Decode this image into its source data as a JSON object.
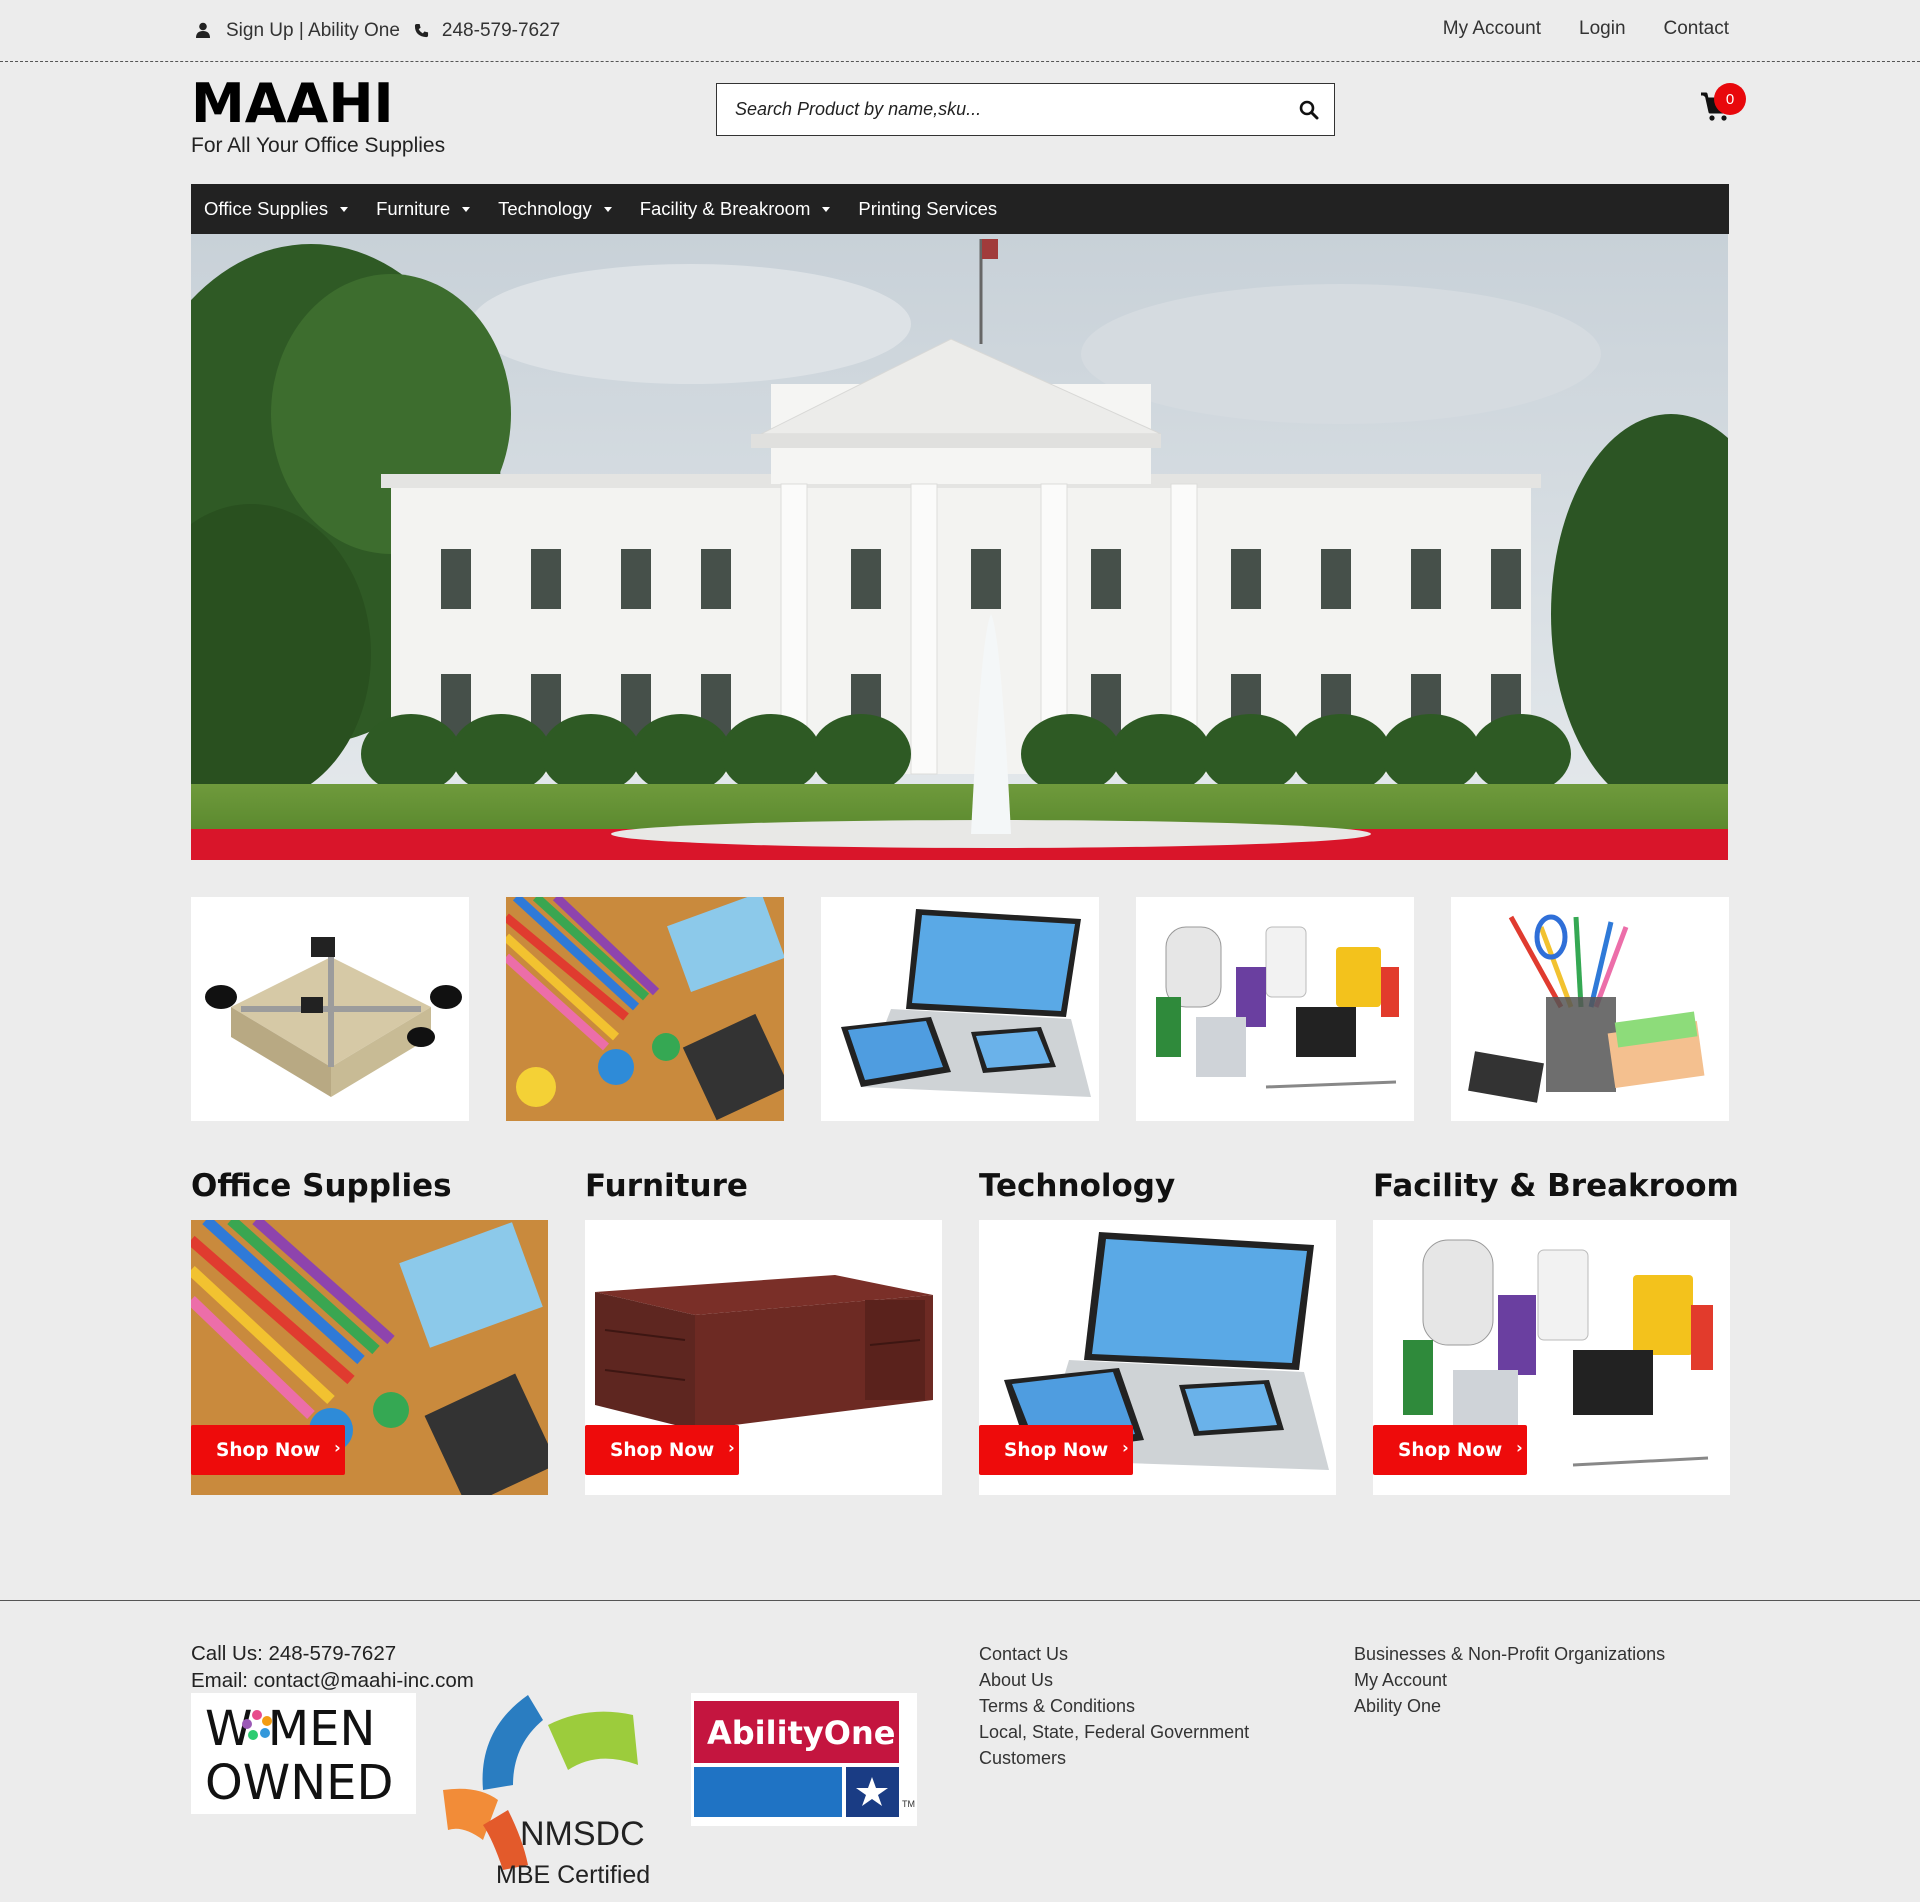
{
  "topbar": {
    "signup_text": "Sign Up | Ability One",
    "phone": "248-579-7627",
    "links": [
      "My Account",
      "Login",
      "Contact"
    ]
  },
  "brand": {
    "logo": "MAAHI",
    "tagline": "For All Your Office Supplies"
  },
  "search": {
    "placeholder": "Search Product by name,sku..."
  },
  "cart": {
    "count": "0"
  },
  "nav": {
    "items": [
      "Office Supplies",
      "Furniture",
      "Technology",
      "Facility & Breakroom",
      "Printing Services"
    ]
  },
  "categories": [
    {
      "title": "Office Supplies",
      "button": "Shop Now"
    },
    {
      "title": "Furniture",
      "button": "Shop Now"
    },
    {
      "title": "Technology",
      "button": "Shop Now"
    },
    {
      "title": "Facility & Breakroom",
      "button": "Shop Now"
    }
  ],
  "footer": {
    "call": "Call Us: 248-579-7627",
    "email": "Email: contact@maahi-inc.com",
    "links_col1": [
      "Contact Us",
      "About Us",
      "Terms & Conditions",
      "Local, State, Federal Government",
      "Customers"
    ],
    "links_col2": [
      "Businesses & Non-Profit Organizations",
      "My Account",
      "Ability One"
    ],
    "badges": {
      "women_line1": "W MEN",
      "women_line2": "OWNED",
      "nmsdc": "NMSDC",
      "mbe": "MBE Certified",
      "ability": "AbilityOne",
      "tm": "TM"
    }
  },
  "colors": {
    "nav_bg": "#222222",
    "accent_red": "#ee0b0b",
    "page_bg": "#ececec"
  }
}
